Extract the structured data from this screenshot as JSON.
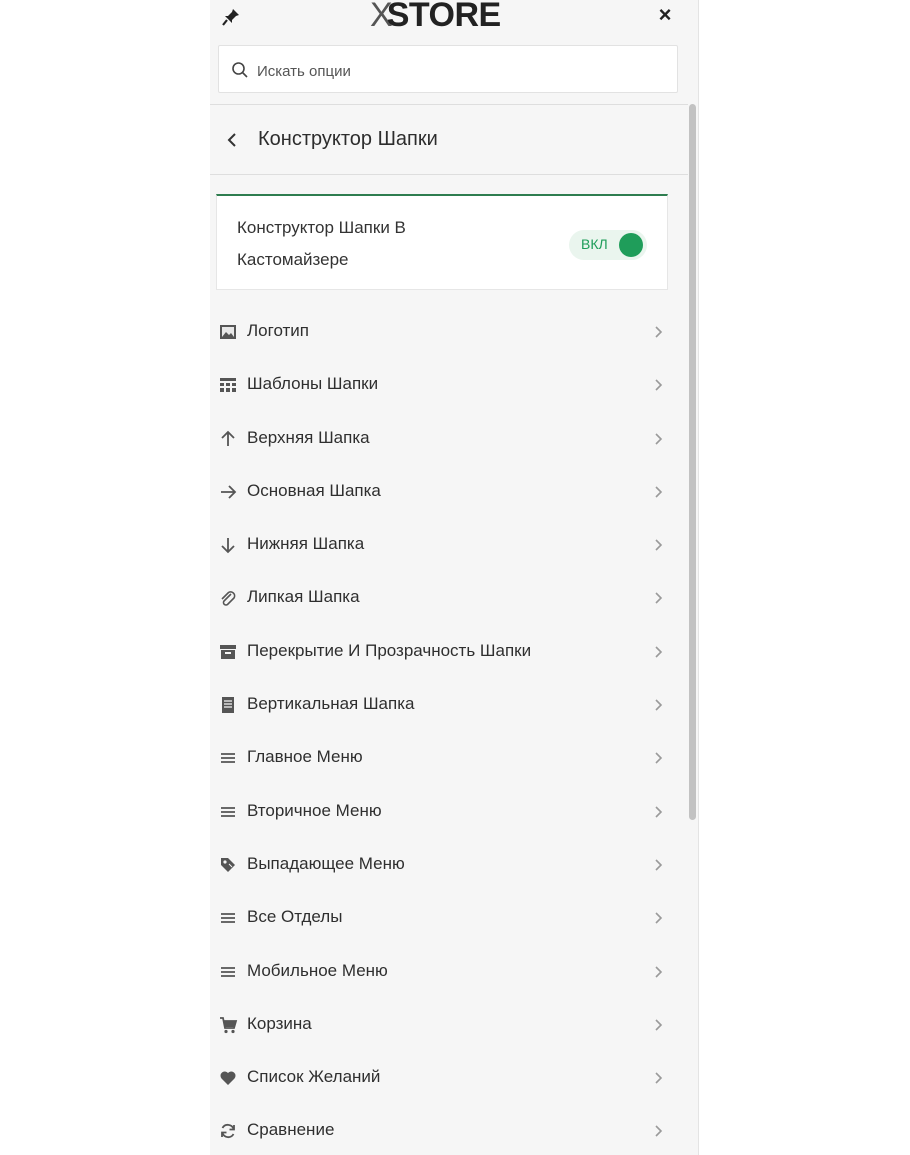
{
  "header": {
    "logo": {
      "x": "X",
      "word": "STORE"
    },
    "close": "×"
  },
  "search": {
    "placeholder": "Искать опции",
    "value": ""
  },
  "section": {
    "title": "Конструктор Шапки"
  },
  "toggle_card": {
    "label": "Конструктор Шапки В Кастомайзере",
    "state": "ВКЛ",
    "on": true,
    "accent": "#1f9d5a"
  },
  "menu": {
    "items": [
      {
        "icon": "image-icon",
        "label": "Логотип"
      },
      {
        "icon": "templates-icon",
        "label": "Шаблоны Шапки"
      },
      {
        "icon": "arrow-up-icon",
        "label": "Верхняя Шапка"
      },
      {
        "icon": "arrow-right-icon",
        "label": "Основная Шапка"
      },
      {
        "icon": "arrow-down-icon",
        "label": "Нижняя Шапка"
      },
      {
        "icon": "paperclip-icon",
        "label": "Липкая Шапка"
      },
      {
        "icon": "archive-icon",
        "label": "Перекрытие И Прозрачность Шапки"
      },
      {
        "icon": "document-icon",
        "label": "Вертикальная Шапка"
      },
      {
        "icon": "menu-lines-icon",
        "label": "Главное Меню"
      },
      {
        "icon": "menu-lines-icon",
        "label": "Вторичное Меню"
      },
      {
        "icon": "tag-icon",
        "label": "Выпадающее Меню"
      },
      {
        "icon": "menu-lines-icon",
        "label": "Все Отделы"
      },
      {
        "icon": "menu-lines-icon",
        "label": "Мобильное Меню"
      },
      {
        "icon": "cart-icon",
        "label": "Корзина"
      },
      {
        "icon": "heart-icon",
        "label": "Список Желаний"
      },
      {
        "icon": "refresh-icon",
        "label": "Сравнение"
      }
    ]
  },
  "colors": {
    "panel_bg": "#f6f6f6",
    "accent": "#2e7d4f",
    "text": "#2f2f2f"
  }
}
